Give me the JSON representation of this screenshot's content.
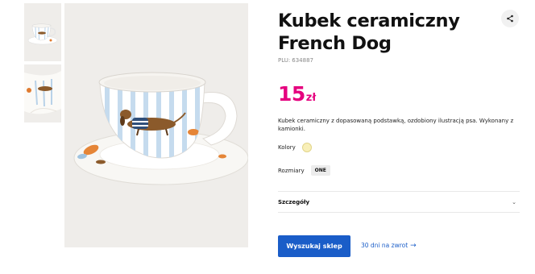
{
  "product": {
    "title": "Kubek ceramiczny French Dog",
    "plu_label": "PLU:",
    "plu_number": "634887",
    "price_value": "15",
    "price_currency": "zł",
    "description": "Kubek ceramiczny z dopasowaną podstawką, ozdobiony ilustracją psa. Wykonany z kamionki."
  },
  "colors": {
    "label": "Kolory",
    "selected_swatch_color": "#f8efb8"
  },
  "sizes": {
    "label": "Rozmiary",
    "options": [
      "ONE"
    ]
  },
  "details": {
    "label": "Szczegóły",
    "icon": "chevron-down-icon"
  },
  "actions": {
    "find_store_label": "Wyszukaj sklep",
    "returns_label": "30 dni na zwrot",
    "returns_icon": "arrow-right-icon",
    "share_icon": "share-icon"
  },
  "gallery": {
    "images": [
      "cup-with-saucer",
      "cup-closeup"
    ]
  },
  "theme": {
    "price_color": "#e5007e",
    "accent_color": "#1a5dc8",
    "image_background": "#efedea"
  }
}
